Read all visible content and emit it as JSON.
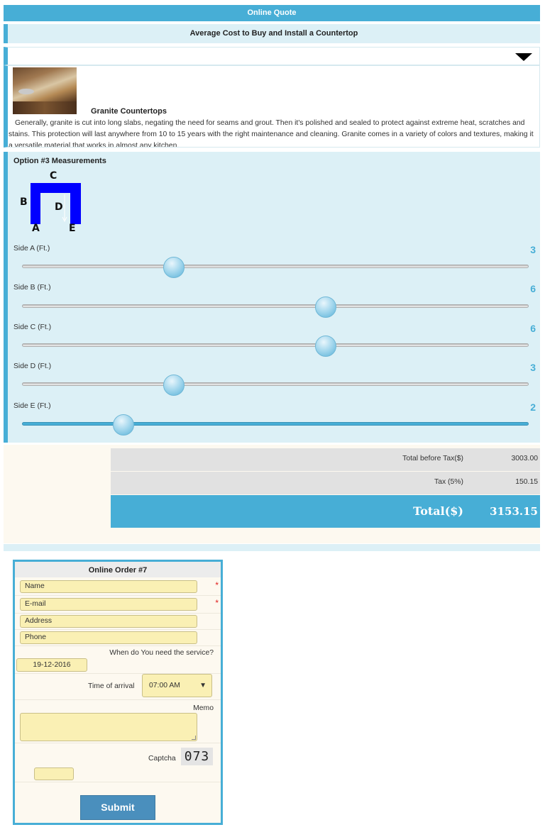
{
  "header": {
    "title": "Online Quote"
  },
  "subheader": {
    "title": "Average Cost to Buy and Install a Countertop"
  },
  "product": {
    "title": "Granite Countertops",
    "description": "Generally, granite is cut into long slabs, negating the need for seams and grout. Then it's polished and sealed to protect against extreme heat, scratches and stains. This protection will last anywhere from 10 to 15 years with the right maintenance and cleaning. Granite comes in a variety of colors and textures, making it a versatile material that works in almost any kitchen."
  },
  "measurements": {
    "title": "Option #3 Measurements",
    "diagram_labels": {
      "a": "A",
      "b": "B",
      "c": "C",
      "d": "D",
      "e": "E"
    },
    "sliders": [
      {
        "label": "Side A (Ft.)",
        "value": "3",
        "fraction": 0.3
      },
      {
        "label": "Side B (Ft.)",
        "value": "6",
        "fraction": 0.6
      },
      {
        "label": "Side C (Ft.)",
        "value": "6",
        "fraction": 0.6
      },
      {
        "label": "Side D (Ft.)",
        "value": "3",
        "fraction": 0.3
      },
      {
        "label": "Side E (Ft.)",
        "value": "2",
        "fraction": 0.2
      }
    ]
  },
  "totals": {
    "before_tax_label": "Total before Tax($)",
    "before_tax_value": "3003.00",
    "tax_label": "Tax (5%)",
    "tax_value": "150.15",
    "total_label": "Total($)",
    "total_value": "3153.15"
  },
  "order": {
    "title": "Online Order #7",
    "name_placeholder": "Name",
    "email_placeholder": "E-mail",
    "address_placeholder": "Address",
    "phone_placeholder": "Phone",
    "required_mark": "*",
    "service_question": "When do You need the service?",
    "service_date": "19-12-2016",
    "arrival_label": "Time of arrival",
    "arrival_value": "07:00 AM",
    "memo_label": "Memo",
    "captcha_label": "Captcha",
    "captcha_text": "073",
    "submit_label": "Submit"
  },
  "colors": {
    "accent": "#47aed6",
    "panel": "#dcf0f6",
    "field": "#faf0b4",
    "diagram": "#0000ff",
    "required": "#e02020"
  },
  "icons": {
    "dropdown": "triangle-down-icon",
    "select_caret": "caret-down-icon"
  }
}
